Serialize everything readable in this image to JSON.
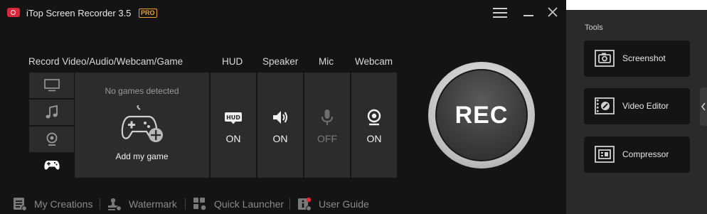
{
  "app": {
    "title": "iTop Screen Recorder 3.5",
    "badge": "PRO"
  },
  "labels": {
    "record": "Record Video/Audio/Webcam/Game",
    "hud": "HUD",
    "speaker": "Speaker",
    "mic": "Mic",
    "webcam": "Webcam"
  },
  "game_panel": {
    "empty_text": "No games detected",
    "add_label": "Add my game"
  },
  "toggles": {
    "hud": {
      "state": "ON",
      "icon": "hud-icon",
      "icon_text": "HUD"
    },
    "speaker": {
      "state": "ON",
      "icon": "speaker-icon"
    },
    "mic": {
      "state": "OFF",
      "icon": "mic-icon"
    },
    "webcam": {
      "state": "ON",
      "icon": "webcam-icon"
    }
  },
  "rec_button": {
    "label": "REC"
  },
  "bottom_bar": [
    {
      "label": "My Creations",
      "icon": "list-icon"
    },
    {
      "label": "Watermark",
      "icon": "watermark-icon"
    },
    {
      "label": "Quick Launcher",
      "icon": "grid-icon"
    },
    {
      "label": "User Guide",
      "icon": "guide-icon"
    }
  ],
  "tools": {
    "title": "Tools",
    "items": [
      {
        "label": "Screenshot",
        "icon": "camera-icon"
      },
      {
        "label": "Video Editor",
        "icon": "film-icon"
      },
      {
        "label": "Compressor",
        "icon": "compress-icon"
      }
    ]
  },
  "colors": {
    "accent": "#d9283a",
    "badge": "#f0a02a",
    "background": "#141414",
    "panel": "#2c2c2c",
    "sidebar": "#2a2a2a"
  }
}
